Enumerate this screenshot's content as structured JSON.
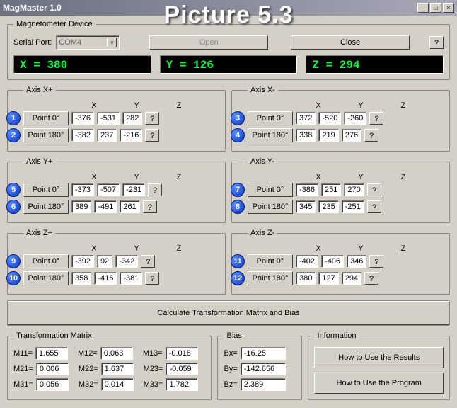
{
  "window": {
    "title": "MagMaster 1.0"
  },
  "overlay": "Picture 5.3",
  "device": {
    "legend": "Magnetometer Device",
    "serial_label": "Serial Port:",
    "serial_value": "COM4",
    "open": "Open",
    "close": "Close",
    "help": "?"
  },
  "readout": {
    "x": "X = 380",
    "y": "Y = 126",
    "z": "Z = 294"
  },
  "cols": {
    "x": "X",
    "y": "Y",
    "z": "Z"
  },
  "axes": [
    {
      "legend": "Axis X+",
      "badge0": "1",
      "badge1": "2",
      "p0": {
        "label": "Point 0°",
        "x": "-376",
        "y": "-531",
        "z": "282"
      },
      "p1": {
        "label": "Point 180°",
        "x": "-382",
        "y": "237",
        "z": "-216"
      }
    },
    {
      "legend": "Axis X-",
      "badge0": "3",
      "badge1": "4",
      "p0": {
        "label": "Point 0°",
        "x": "372",
        "y": "-520",
        "z": "-260"
      },
      "p1": {
        "label": "Point 180°",
        "x": "338",
        "y": "219",
        "z": "276"
      }
    },
    {
      "legend": "Axis Y+",
      "badge0": "5",
      "badge1": "6",
      "p0": {
        "label": "Point 0°",
        "x": "-373",
        "y": "-507",
        "z": "-231"
      },
      "p1": {
        "label": "Point 180°",
        "x": "389",
        "y": "-491",
        "z": "261"
      }
    },
    {
      "legend": "Axis Y-",
      "badge0": "7",
      "badge1": "8",
      "p0": {
        "label": "Point 0°",
        "x": "-386",
        "y": "251",
        "z": "270"
      },
      "p1": {
        "label": "Point 180°",
        "x": "345",
        "y": "235",
        "z": "-251"
      }
    },
    {
      "legend": "Axis Z+",
      "badge0": "9",
      "badge1": "10",
      "p0": {
        "label": "Point 0°",
        "x": "-392",
        "y": "92",
        "z": "-342"
      },
      "p1": {
        "label": "Point 180°",
        "x": "358",
        "y": "-416",
        "z": "-381"
      }
    },
    {
      "legend": "Axis Z-",
      "badge0": "11",
      "badge1": "12",
      "p0": {
        "label": "Point 0°",
        "x": "-402",
        "y": "-406",
        "z": "346"
      },
      "p1": {
        "label": "Point 180°",
        "x": "380",
        "y": "127",
        "z": "294"
      }
    }
  ],
  "calc_btn": "Calculate Transformation Matrix and Bias",
  "matrix": {
    "legend": "Transformation Matrix",
    "labels": [
      "M11=",
      "M12=",
      "M13=",
      "M21=",
      "M22=",
      "M23=",
      "M31=",
      "M32=",
      "M33="
    ],
    "vals": [
      "1.655",
      "0.063",
      "-0.018",
      "0.006",
      "1.637",
      "-0.059",
      "0.056",
      "0.014",
      "1.782"
    ]
  },
  "bias": {
    "legend": "Bias",
    "labels": [
      "Bx=",
      "By=",
      "Bz="
    ],
    "vals": [
      "-16.25",
      "-142.656",
      "2.389"
    ]
  },
  "info": {
    "legend": "Information",
    "results": "How to Use the Results",
    "program": "How to Use the Program"
  },
  "help_q": "?"
}
